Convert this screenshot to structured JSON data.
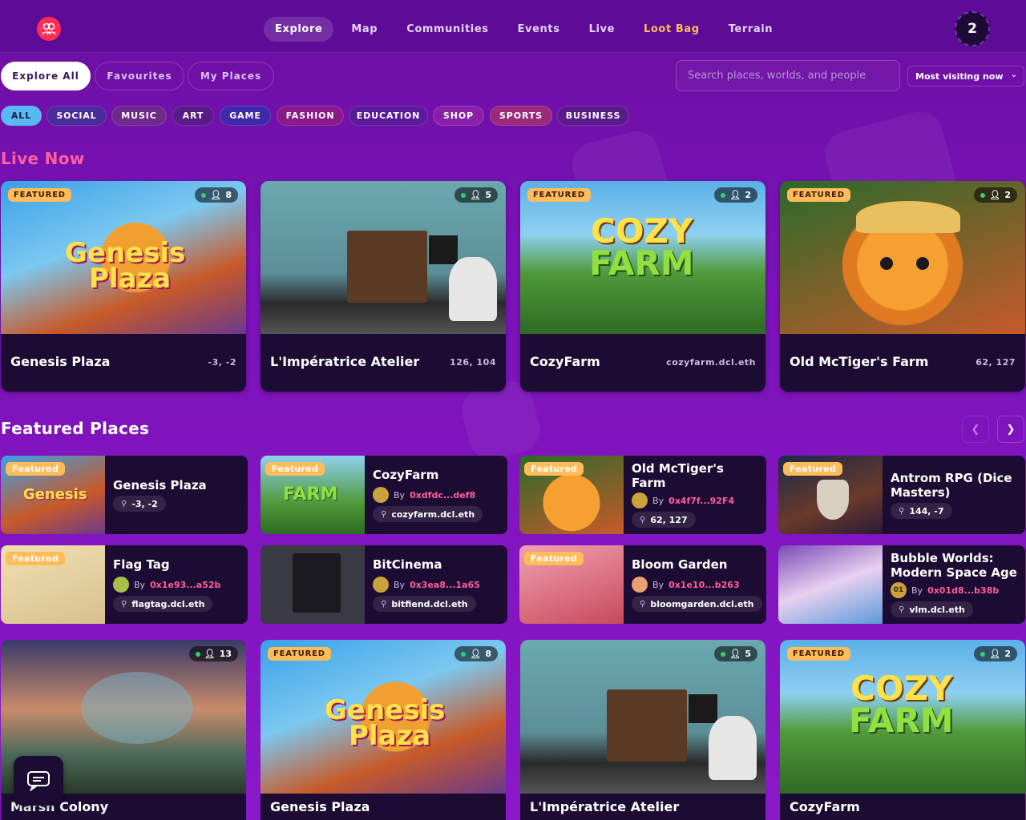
{
  "nav": {
    "items": [
      "Explore",
      "Map",
      "Communities",
      "Events",
      "Live",
      "Loot Bag",
      "Terrain"
    ],
    "avatar_count": "2"
  },
  "tabs": [
    "Explore All",
    "Favourites",
    "My Places"
  ],
  "search": {
    "placeholder": "Search places, worlds, and people"
  },
  "sort": {
    "selected": "Most visiting now"
  },
  "categories": [
    "ALL",
    "SOCIAL",
    "MUSIC",
    "ART",
    "GAME",
    "FASHION",
    "EDUCATION",
    "SHOP",
    "SPORTS",
    "BUSINESS"
  ],
  "live": {
    "heading": "Live Now",
    "cards": [
      {
        "title": "Genesis Plaza",
        "coords": "-3, -2",
        "users": "8",
        "badge": "FEATURED"
      },
      {
        "title": "L'Impératrice Atelier",
        "coords": "126, 104",
        "users": "5",
        "badge": ""
      },
      {
        "title": "CozyFarm",
        "coords": "cozyfarm.dcl.eth",
        "users": "2",
        "badge": "FEATURED"
      },
      {
        "title": "Old McTiger's Farm",
        "coords": "62, 127",
        "users": "2",
        "badge": "FEATURED"
      }
    ]
  },
  "featured": {
    "heading": "Featured Places",
    "badge": "Featured",
    "cards": [
      {
        "title": "Genesis Plaza",
        "by": "",
        "owner": "",
        "loc": "-3, -2"
      },
      {
        "title": "CozyFarm",
        "by": "By",
        "owner": "0xdfdc...def8",
        "loc": "cozyfarm.dcl.eth"
      },
      {
        "title": "Old McTiger's Farm",
        "by": "By",
        "owner": "0x4f7f...92F4",
        "loc": "62, 127"
      },
      {
        "title": "Antrom RPG (Dice Masters)",
        "by": "",
        "owner": "",
        "loc": "144, -7"
      },
      {
        "title": "Flag Tag",
        "by": "By",
        "owner": "0x1e93...a52b",
        "loc": "flagtag.dcl.eth"
      },
      {
        "title": "BitCinema",
        "by": "By",
        "owner": "0x3ea8...1a65",
        "loc": "bitfiend.dcl.eth"
      },
      {
        "title": "Bloom Garden",
        "by": "By",
        "owner": "0x1e10...b263",
        "loc": "bloomgarden.dcl.eth"
      },
      {
        "title": "Bubble Worlds: Modern Space Age",
        "by": "By",
        "owner": "0x01d8...b38b",
        "loc": "vlm.dcl.eth",
        "avatar": "01"
      }
    ]
  },
  "bottom": {
    "cards": [
      {
        "title": "Marsh Colony",
        "users": "13",
        "badge": ""
      },
      {
        "title": "Genesis Plaza",
        "users": "8",
        "badge": "FEATURED"
      },
      {
        "title": "L'Impératrice Atelier",
        "users": "5",
        "badge": ""
      },
      {
        "title": "CozyFarm",
        "users": "2",
        "badge": "FEATURED"
      }
    ]
  },
  "colors": {
    "accent": "#ffbc5b",
    "live_heading": "#ff5f9e",
    "nav_bg": "#5e0c97",
    "card_bg": "#1c0b33",
    "owner": "#ff5f9e"
  }
}
